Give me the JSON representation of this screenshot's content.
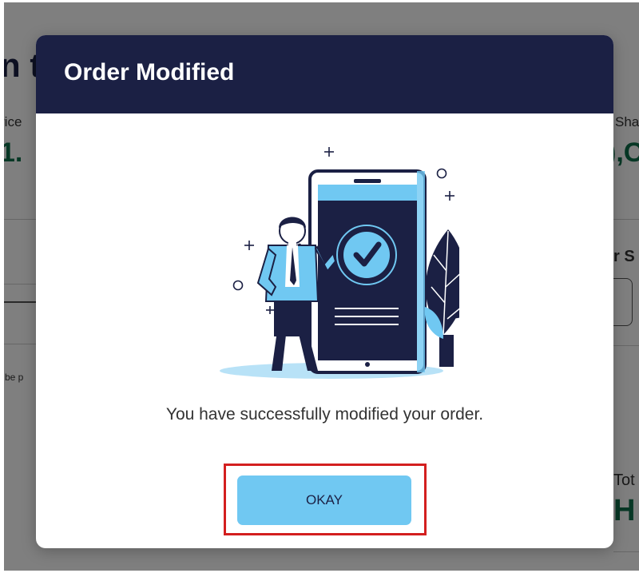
{
  "background": {
    "heading_fragment": "n t",
    "left_label": "rice",
    "left_value": "1.",
    "right_label": "Sha",
    "right_value": "),C",
    "right_label_2": "r S",
    "note_fragment": "l be p",
    "total_label": "Tot",
    "total_value": "H"
  },
  "modal": {
    "title": "Order Modified",
    "message": "You have successfully modified your order.",
    "okay_label": "OKAY"
  },
  "colors": {
    "header_bg": "#1b2044",
    "button_bg": "#70c8f2",
    "highlight": "#d31f1f",
    "accent_green": "#0f6e4a"
  },
  "illustration": {
    "icon": "success-checkmark-icon",
    "subject": "person-with-phone-illustration"
  }
}
